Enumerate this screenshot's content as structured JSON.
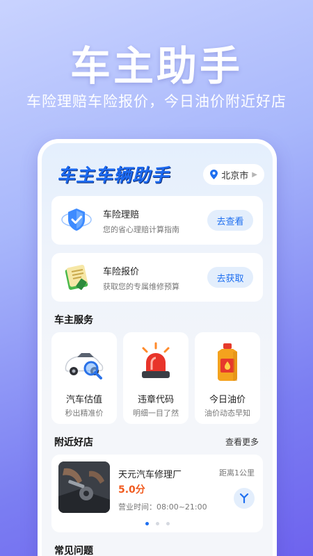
{
  "hero": {
    "title": "车主助手",
    "subtitle": "车险理赔车险报价，今日油价附近好店"
  },
  "app": {
    "logo_text": "车主车辆助手",
    "city": "北京市"
  },
  "cards": [
    {
      "title": "车险理赔",
      "desc": "您的省心理赔计算指南",
      "button": "去查看",
      "icon": "shield-check-icon"
    },
    {
      "title": "车险报价",
      "desc": "获取您的专属维修预算",
      "button": "去获取",
      "icon": "document-icon"
    }
  ],
  "services": {
    "section_title": "车主服务",
    "items": [
      {
        "name": "汽车估值",
        "sub": "秒出精准价",
        "icon": "car-magnifier-icon"
      },
      {
        "name": "违章代码",
        "sub": "明细一目了然",
        "icon": "siren-icon"
      },
      {
        "name": "今日油价",
        "sub": "油价动态早知",
        "icon": "oil-can-icon"
      }
    ]
  },
  "nearby": {
    "section_title": "附近好店",
    "more_label": "查看更多",
    "shop": {
      "name": "天元汽车修理厂",
      "score": "5.0分",
      "hours": "营业时间：08:00~21:00",
      "distance": "距离1公里"
    },
    "pagination": {
      "count": 3,
      "active": 1
    }
  },
  "faq": {
    "section_title": "常见问题"
  },
  "colors": {
    "accent": "#1e6ff0",
    "score": "#f05a1e",
    "button_bg": "#e3eefc"
  }
}
